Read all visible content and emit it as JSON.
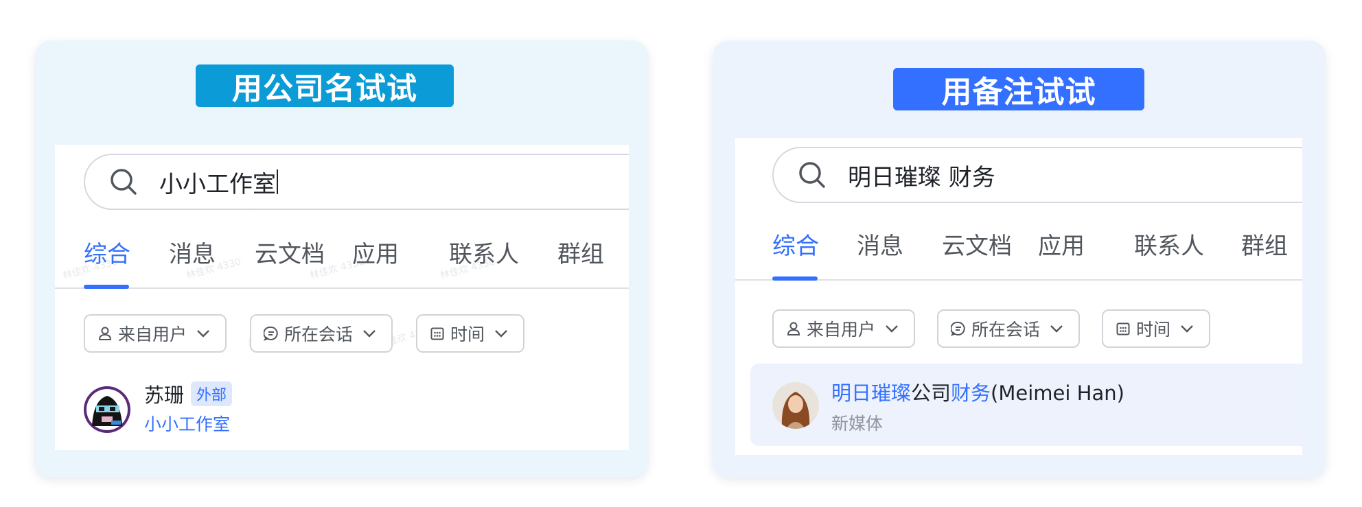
{
  "left_card": {
    "title": "用公司名试试",
    "search_value": "小小工作室",
    "tabs": [
      "综合",
      "消息",
      "云文档",
      "应用",
      "联系人",
      "群组"
    ],
    "active_tab": "综合",
    "filters": [
      {
        "label": "来自用户",
        "icon": "user-icon"
      },
      {
        "label": "所在会话",
        "icon": "chat-bubble-icon"
      },
      {
        "label": "时间",
        "icon": "calendar-icon"
      }
    ],
    "result": {
      "name": "苏珊",
      "tag": "外部",
      "company": "小小工作室"
    }
  },
  "right_card": {
    "title": "用备注试试",
    "search_value": "明日璀璨 财务",
    "tabs": [
      "综合",
      "消息",
      "云文档",
      "应用",
      "联系人",
      "群组"
    ],
    "active_tab": "综合",
    "filters": [
      {
        "label": "来自用户",
        "icon": "user-icon"
      },
      {
        "label": "所在会话",
        "icon": "chat-bubble-icon"
      },
      {
        "label": "时间",
        "icon": "calendar-icon"
      }
    ],
    "result": {
      "name_parts": [
        "明日璀璨",
        "公司",
        "财务",
        "(Meimei Han)"
      ],
      "subtitle": "新媒体"
    }
  },
  "colors": {
    "accent_blue": "#3370ff",
    "left_badge": "#0b9bd6",
    "right_badge": "#3370ff",
    "left_card_bg": "#eaf5fc",
    "right_card_bg": "#edf3fd"
  }
}
